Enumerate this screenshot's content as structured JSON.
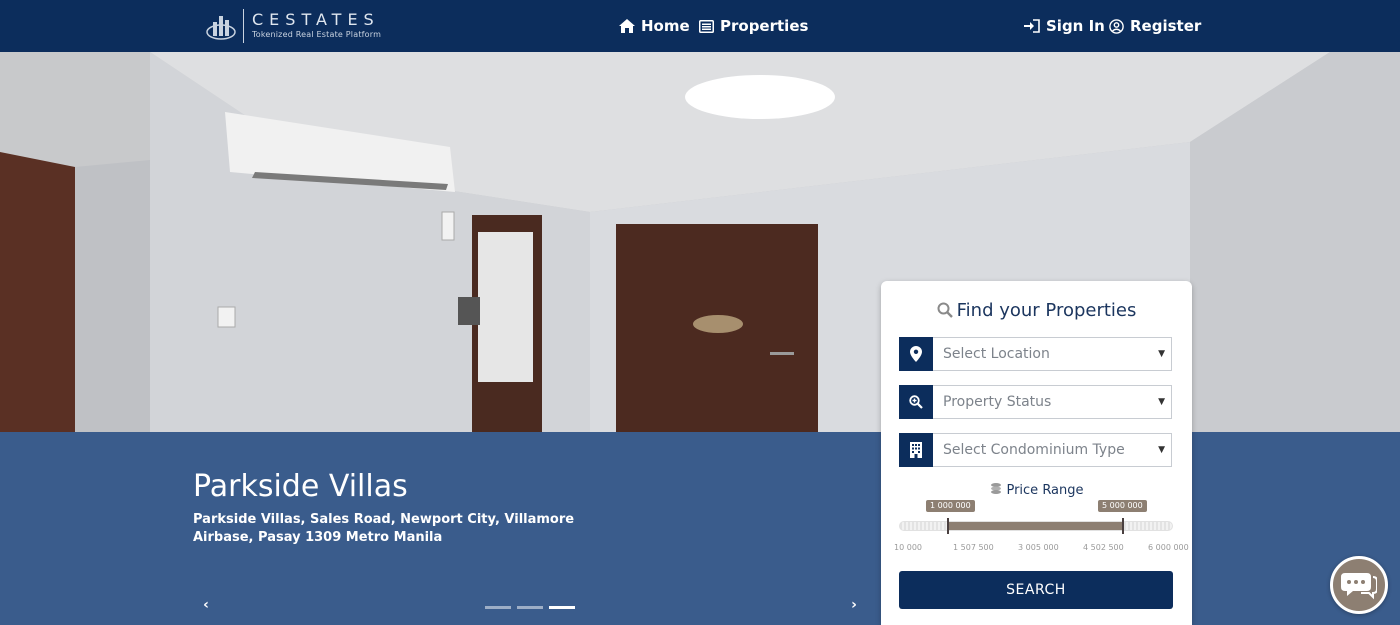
{
  "brand": {
    "name": "CESTATES",
    "tagline": "Tokenized Real Estate Platform"
  },
  "nav": {
    "home": "Home",
    "properties": "Properties",
    "sign_in": "Sign In",
    "register": "Register"
  },
  "hero": {
    "title": "Parkside Villas",
    "address": "Parkside Villas, Sales Road, Newport City, Villamore Airbase, Pasay 1309 Metro Manila",
    "prev": "‹",
    "next": "›",
    "slides_total": 3,
    "active_slide": 3
  },
  "search": {
    "title": "Find your Properties",
    "location_placeholder": "Select Location",
    "status_placeholder": "Property Status",
    "condo_type_placeholder": "Select Condominium Type",
    "price_label": "Price Range",
    "min_value": "1 000 000",
    "max_value": "5 000 000",
    "scale": [
      "10 000",
      "1 507 500",
      "3 005 000",
      "4 502 500",
      "6 000 000"
    ],
    "button": "SEARCH"
  },
  "icons": {
    "logo": "building-logo-icon",
    "home": "home-icon",
    "properties": "list-icon",
    "sign_in": "sign-in-icon",
    "register": "user-circle-icon",
    "search": "search-icon",
    "location": "map-marker-icon",
    "status": "search-plus-icon",
    "condo": "building-icon",
    "price": "coins-icon",
    "chat": "chat-bubbles-icon"
  },
  "colors": {
    "navbar": "#0c2d5c",
    "band": "#2b5794",
    "accent": "#8d7f72",
    "panel_text": "#1b355e"
  }
}
